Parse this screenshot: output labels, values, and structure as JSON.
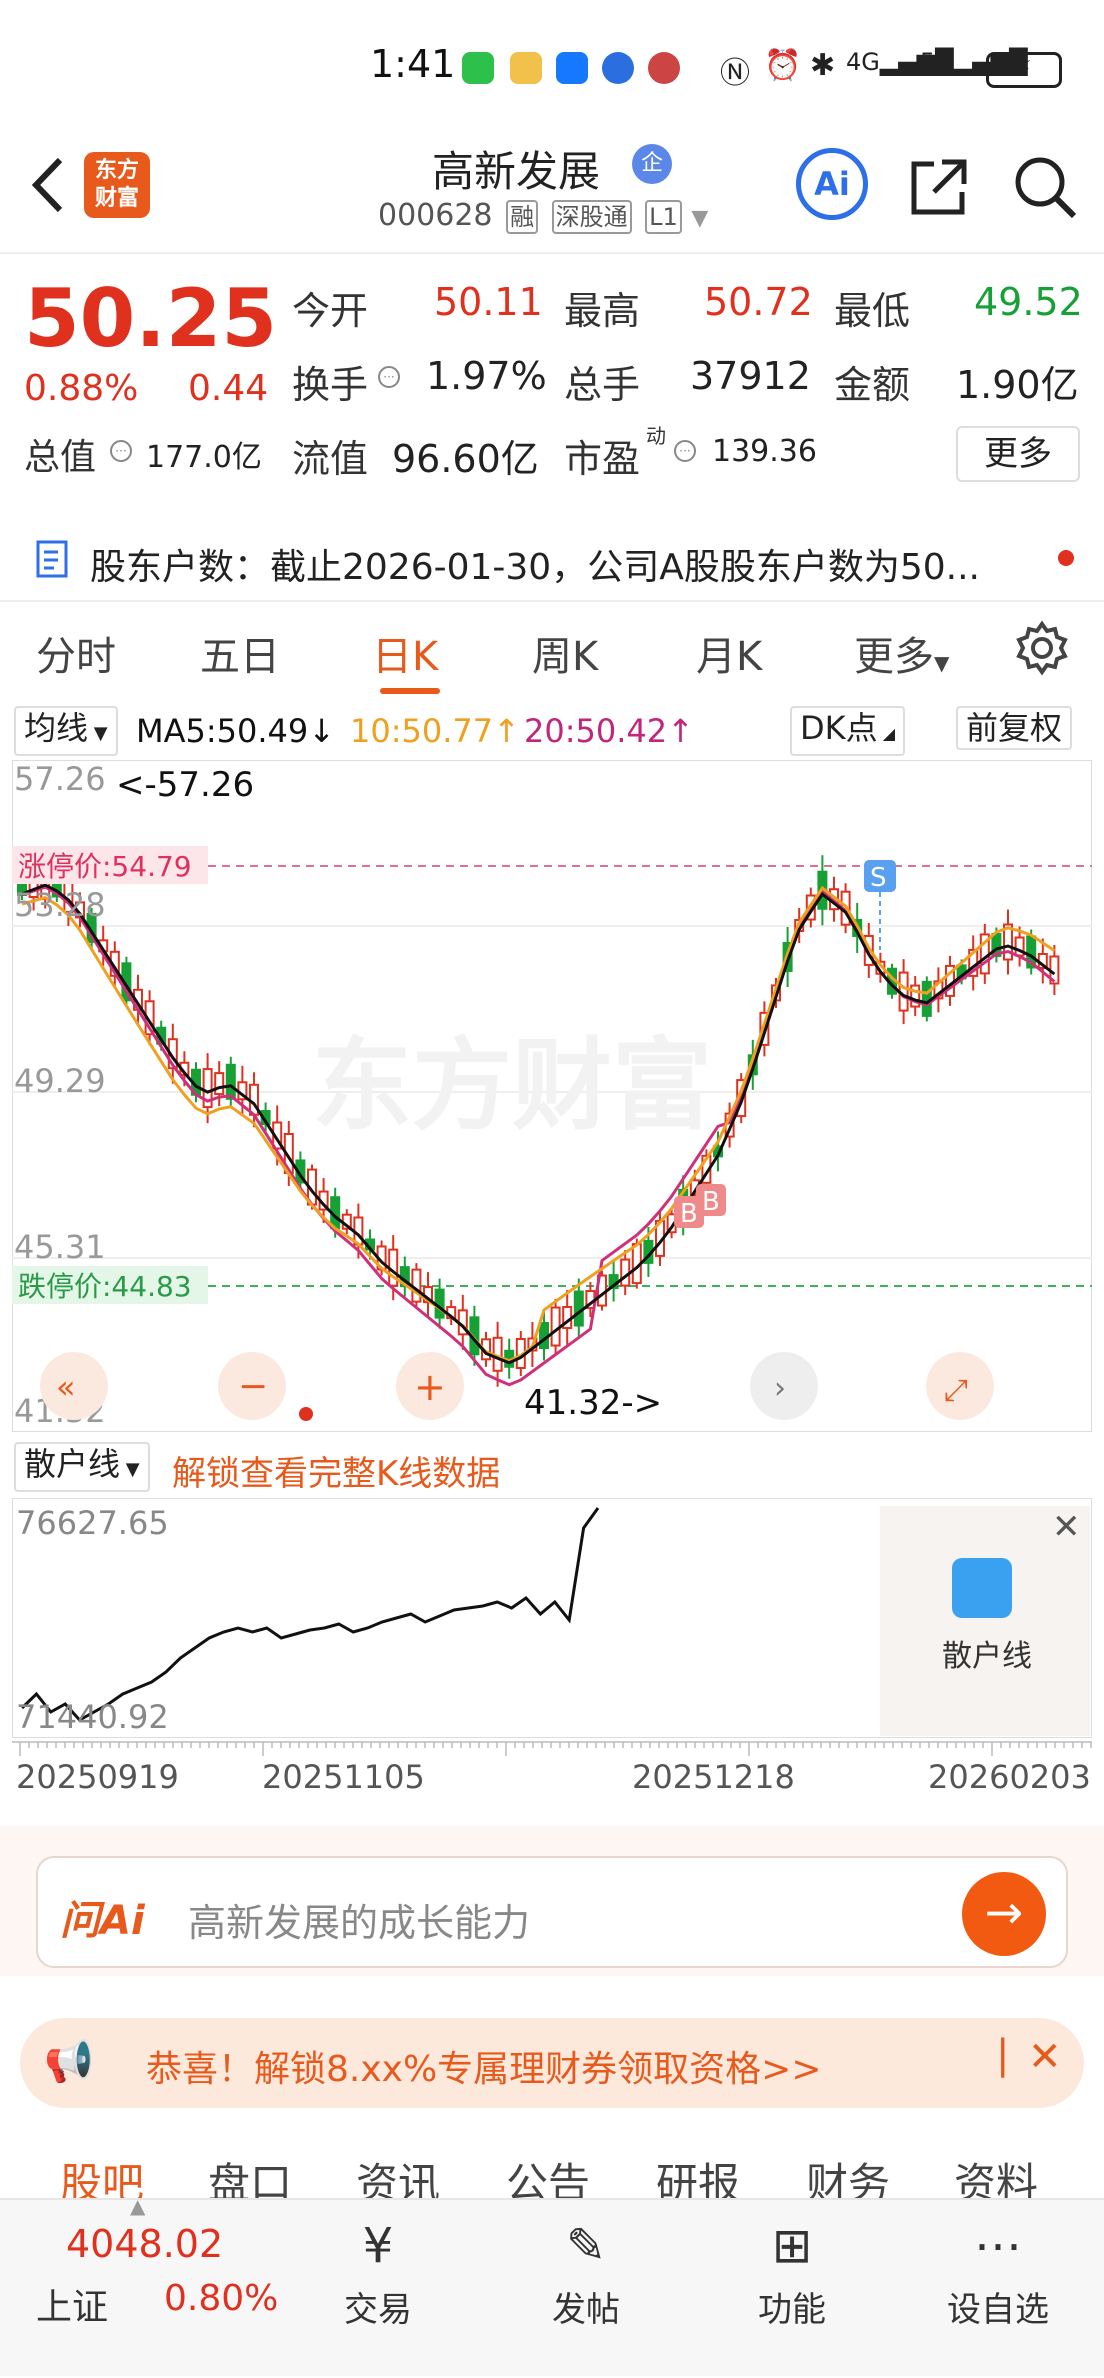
{
  "status": {
    "time": "1:41"
  },
  "header": {
    "logo_text": "东方\n财富",
    "name": "高新发展",
    "badge": "企",
    "code": "000628",
    "tags": [
      "融",
      "深股通",
      "L1"
    ]
  },
  "quote": {
    "price": "50.25",
    "pct": "0.88%",
    "chg": "0.44",
    "fields": [
      {
        "label": "今开",
        "value": "50.11"
      },
      {
        "label": "最高",
        "value": "50.72"
      },
      {
        "label": "最低",
        "value": "49.52"
      },
      {
        "label": "换手",
        "value": "1.97%"
      },
      {
        "label": "总手",
        "value": "37912"
      },
      {
        "label": "金额",
        "value": "1.90亿"
      },
      {
        "label": "总值",
        "value": "177.0亿"
      },
      {
        "label": "流值",
        "value": "96.60亿"
      },
      {
        "label": "市盈",
        "sup": "动",
        "value": "139.36"
      }
    ],
    "more_label": "更多"
  },
  "notice": {
    "text": "股东户数：截止2026-01-30，公司A股股东户数为50..."
  },
  "tabs": [
    "分时",
    "五日",
    "日K",
    "周K",
    "月K",
    "更多"
  ],
  "ma": {
    "selector": "均线",
    "ma5": "MA5:50.49",
    "ma5_arrow": "↓",
    "ma10": "10:50.77",
    "ma10_arrow": "↑",
    "ma20": "20:50.42",
    "ma20_arrow": "↑",
    "dk": "DK点",
    "fq": "前复权"
  },
  "chart_data": [
    {
      "type": "candlestick",
      "title": "日K",
      "ylabels": [
        "57.26",
        "53.28",
        "49.29",
        "45.31",
        "41.32"
      ],
      "high_marker": "<-57.26",
      "low_marker": "41.32->",
      "limit_up": "涨停价:54.79",
      "limit_down": "跌停价:44.83",
      "markers": [
        "B",
        "B",
        "S"
      ],
      "series": [
        {
          "name": "MA5",
          "color": "#111111"
        },
        {
          "name": "10",
          "color": "#f0a020"
        },
        {
          "name": "20",
          "color": "#d0307a"
        }
      ],
      "watermark": "东方财富"
    },
    {
      "type": "line",
      "title": "散户线",
      "yrange": [
        "76627.65",
        "71440.92"
      ],
      "x": [
        "20250919",
        "20251105",
        "20251218",
        "20260203"
      ]
    }
  ],
  "retail": {
    "selector": "散户线",
    "unlock": "解锁查看完整K线数据",
    "side_label": "散户线"
  },
  "ai": {
    "logo": "问Ai",
    "placeholder": "高新发展的成长能力"
  },
  "promo": {
    "text": "恭喜！解锁8.xx%专属理财券领取资格>>"
  },
  "bottom_tabs": [
    "股吧",
    "盘口",
    "资讯",
    "公告",
    "研报",
    "财务",
    "资料"
  ],
  "nav": {
    "index_value": "4048.02",
    "index_name": "上证",
    "index_pct": "0.80%",
    "items": [
      "交易",
      "发帖",
      "功能",
      "设自选"
    ]
  }
}
